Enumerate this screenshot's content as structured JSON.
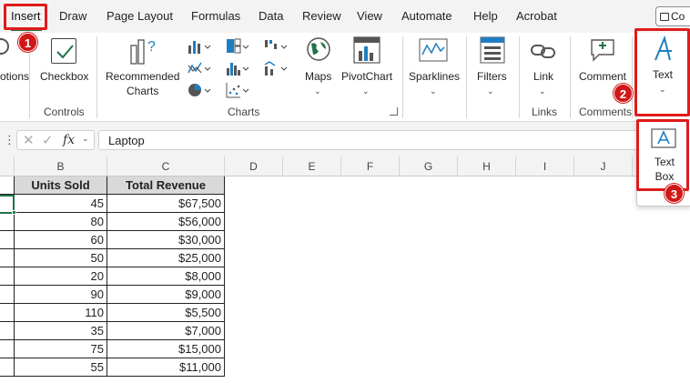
{
  "menu": {
    "tabs": [
      "Insert",
      "Draw",
      "Page Layout",
      "Formulas",
      "Data",
      "Review",
      "View",
      "Automate",
      "Help",
      "Acrobat"
    ],
    "comments_button": "Co"
  },
  "ribbon": {
    "partial_left_label": "otions",
    "checkbox_label": "Checkbox",
    "controls_group": "Controls",
    "recommended_charts": "Recommended",
    "recommended_charts_line2": "Charts",
    "charts_group": "Charts",
    "maps_label": "Maps",
    "pivotchart_label": "PivotChart",
    "sparklines_label": "Sparklines",
    "filters_label": "Filters",
    "link_label": "Link",
    "links_group": "Links",
    "comment_label": "Comment",
    "comments_group": "Comments",
    "text_label": "Text",
    "textbox_label": "Text",
    "textbox_label_line2": "Box"
  },
  "formula_bar": {
    "fx": "fx",
    "value": "Laptop"
  },
  "grid": {
    "columns": [
      "B",
      "C",
      "D",
      "E",
      "F",
      "G",
      "H",
      "I",
      "J"
    ],
    "headers": [
      "Units Sold",
      "Total Revenue"
    ],
    "rows": [
      {
        "units": "45",
        "revenue": "$67,500"
      },
      {
        "units": "80",
        "revenue": "$56,000"
      },
      {
        "units": "60",
        "revenue": "$30,000"
      },
      {
        "units": "50",
        "revenue": "$25,000"
      },
      {
        "units": "20",
        "revenue": "$8,000"
      },
      {
        "units": "90",
        "revenue": "$9,000"
      },
      {
        "units": "110",
        "revenue": "$5,500"
      },
      {
        "units": "35",
        "revenue": "$7,000"
      },
      {
        "units": "75",
        "revenue": "$15,000"
      },
      {
        "units": "55",
        "revenue": "$11,000"
      }
    ]
  },
  "annotations": {
    "step1": "1",
    "step2": "2",
    "step3": "3",
    "color": "#e01b1b"
  },
  "colors": {
    "accent": "#1f7ec2",
    "excel_green": "#217346",
    "annotation_red": "#e01b1b"
  }
}
